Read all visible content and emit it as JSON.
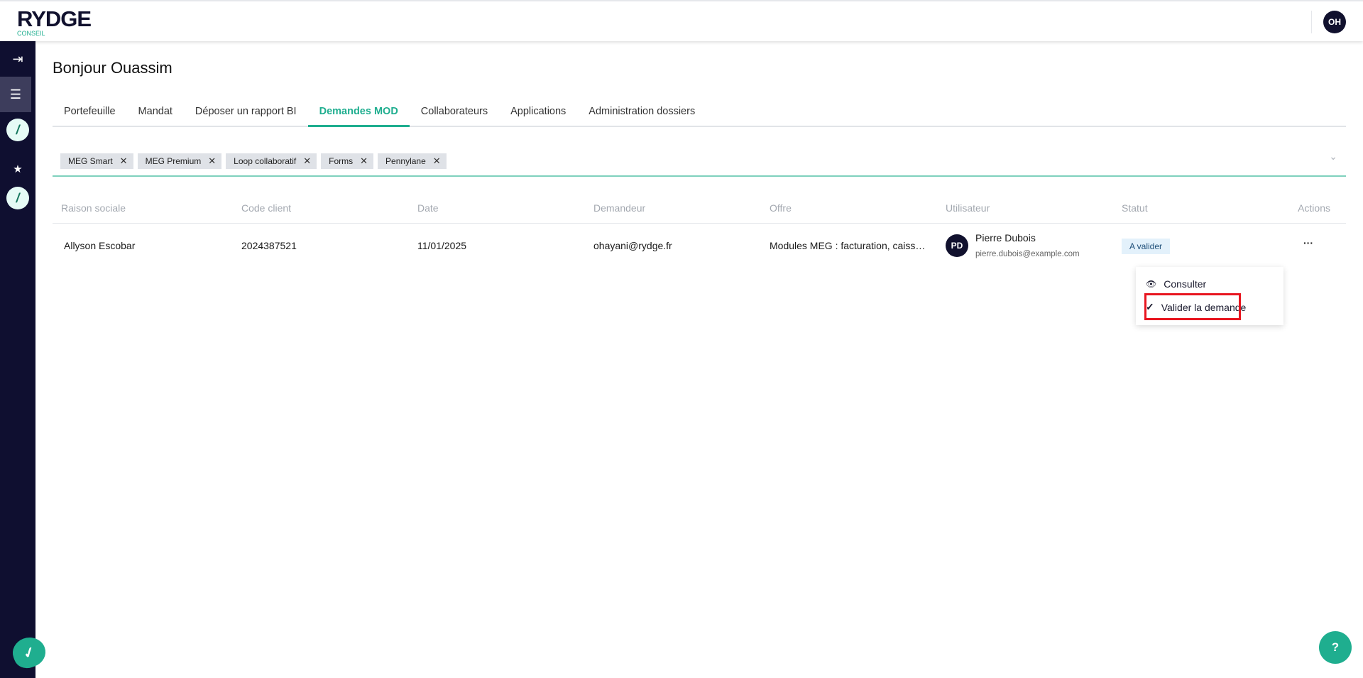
{
  "header": {
    "logo_text": "RYDGE",
    "logo_sub": "CONSEIL",
    "user_initials": "OH"
  },
  "sidebar": {
    "items": [
      {
        "icon": "collapse-arrow-icon",
        "glyph": "⇥"
      },
      {
        "icon": "list-icon",
        "glyph": "☰"
      },
      {
        "icon": "app-icon",
        "glyph": "/"
      },
      {
        "icon": "star-icon",
        "glyph": "★"
      },
      {
        "icon": "app-icon",
        "glyph": "/"
      }
    ],
    "bottom_logo": "✓"
  },
  "page": {
    "title": "Bonjour Ouassim"
  },
  "tabs": [
    {
      "label": "Portefeuille"
    },
    {
      "label": "Mandat"
    },
    {
      "label": "Déposer un rapport BI"
    },
    {
      "label": "Demandes MOD",
      "active": true
    },
    {
      "label": "Collaborateurs"
    },
    {
      "label": "Applications"
    },
    {
      "label": "Administration dossiers"
    }
  ],
  "filters": {
    "chips": [
      "MEG Smart",
      "MEG Premium",
      "Loop collaboratif",
      "Forms",
      "Pennylane"
    ],
    "remove_glyph": "✕",
    "chevron": "⌄"
  },
  "table": {
    "columns": [
      "Raison sociale",
      "Code client",
      "Date",
      "Demandeur",
      "Offre",
      "Utilisateur",
      "Statut",
      "Actions"
    ],
    "rows": [
      {
        "raison_sociale": "Allyson Escobar",
        "code_client": "2024387521",
        "date": "11/01/2025",
        "demandeur": "ohayani@rydge.fr",
        "offre": "Modules MEG : facturation, caiss…",
        "user_initials": "PD",
        "user_name": "Pierre Dubois",
        "user_email": "pierre.dubois@example.com",
        "statut": "A valider",
        "actions": "···"
      }
    ]
  },
  "action_menu": {
    "items": [
      {
        "label": "Consulter",
        "icon": "eye-icon",
        "glyph": "👁"
      },
      {
        "label": "Valider la demande",
        "icon": "check-icon",
        "glyph": "✓",
        "highlighted": true
      }
    ]
  },
  "help": {
    "label": "?"
  },
  "colors": {
    "accent": "#1fae8f",
    "sidebar": "#0f0f30",
    "highlight": "#e8151f"
  }
}
